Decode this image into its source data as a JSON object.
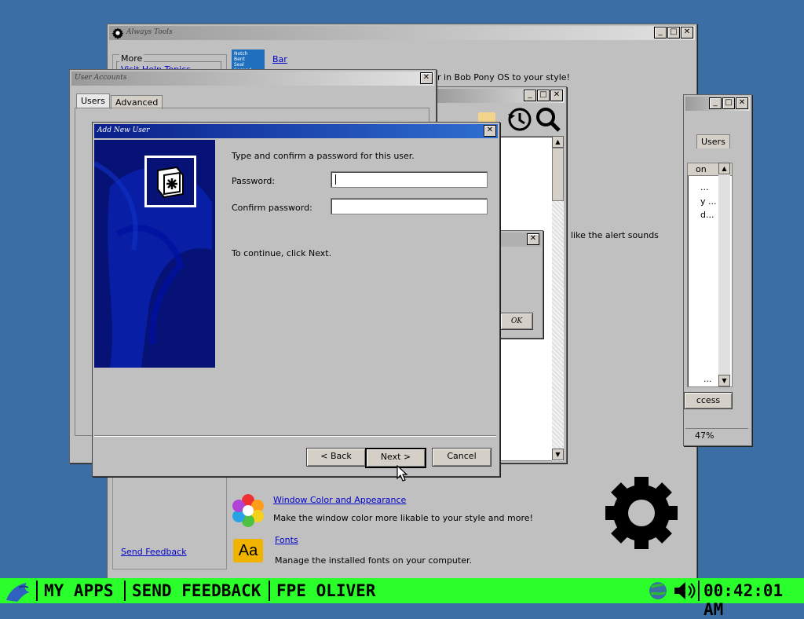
{
  "control_panel": {
    "more_label": "More",
    "help_link": "Visit Help Topics",
    "bar_link": "Bar",
    "personalize_text": "r in Bob Pony OS to your style!",
    "sounds_text": "like the alert sounds",
    "window_color_link": "Window Color and Appearance",
    "window_color_desc": "Make the window color more likable to your style and more!",
    "fonts_link": "Fonts",
    "fonts_desc": "Manage the installed fonts on your computer.",
    "fonts_icon_text": "Aa",
    "send_feedback_link": "Send Feedback",
    "bar_icon_lines": [
      "Notch",
      "Bent",
      "Seal Second"
    ]
  },
  "user_accounts": {
    "tab_users": "Users",
    "tab_advanced": "Advanced"
  },
  "right_window": {
    "tab_users": "Users",
    "col_header": "on",
    "rows": [
      "...",
      "y ...",
      "d..."
    ],
    "bottom_row": "...",
    "button": "ccess",
    "status": "47%"
  },
  "msgbox": {
    "ok_label": "OK"
  },
  "dialog": {
    "instruction": "Type and confirm a password for this user.",
    "password_label": "Password:",
    "confirm_label": "Confirm password:",
    "password_value": "",
    "confirm_value": "",
    "continue_text": "To continue, click Next.",
    "back_label": "< Back",
    "next_label": "Next >",
    "cancel_label": "Cancel"
  },
  "taskbar": {
    "my_apps": "MY APPS",
    "send_feedback": "SEND FEEDBACK",
    "user": "FPE OLIVER",
    "clock": "00:42:01 AM"
  },
  "colors": {
    "desktop": "#3a6ea5",
    "taskbar": "#2bff2b",
    "dialog_title": "#0a1f8a",
    "wizard_panel": "#061275"
  },
  "icons": [
    "gear-icon",
    "history-icon",
    "magnify-icon",
    "folder-icon",
    "color-wheel-icon",
    "fonts-icon",
    "volume-icon",
    "network-icon",
    "key-icon",
    "bird-icon"
  ]
}
